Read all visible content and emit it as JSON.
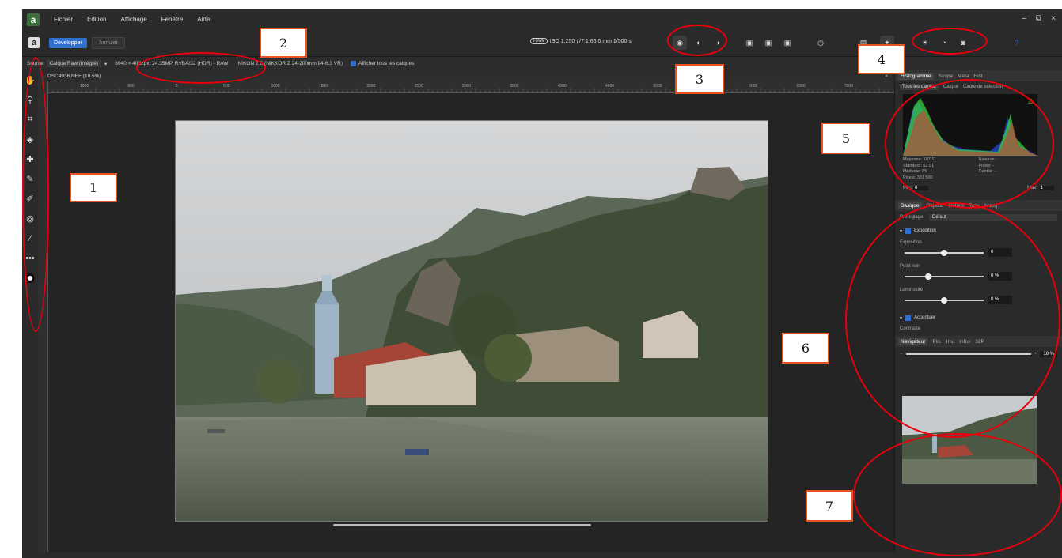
{
  "menubar": {
    "items": [
      "Fichier",
      "Edition",
      "Affichage",
      "Fenêtre",
      "Aide"
    ],
    "logo": "a"
  },
  "toolbar": {
    "develop_label": "Développer",
    "cancel_label": "Annuler",
    "raw_badge": "RAW",
    "exif": "ISO 1,250 ƒ/7.1 66.0 mm 1/500 s"
  },
  "context": {
    "source_label": "Source",
    "layer_select": "Calque Raw (intégré)",
    "dimensions": "6040 × 4032px, 24.35MP, RVBA/32 (HDR) - RAW",
    "camera": "NIKON Z 5 (NIKKOR Z 24-200mm f/4-6.3 VR)",
    "show_layers": "Afficher tous les calques"
  },
  "document": {
    "tab": "DSC4936.NEF (18.5%)",
    "close": "×"
  },
  "ruler": {
    "ticks": [
      "1000",
      "800",
      "0",
      "500",
      "1000",
      "1500",
      "2000",
      "2500",
      "3000",
      "3500",
      "4000",
      "4500",
      "5000",
      "5500",
      "6000",
      "6500",
      "7000"
    ]
  },
  "histogram": {
    "tabs": [
      "Histogramme",
      "Scope",
      "Méta",
      "Hist"
    ],
    "channel": "Tous les canaux",
    "options": [
      "Calque",
      "Cadre de sélection"
    ],
    "stats": [
      "Moyenne: 107.11",
      "Niveaux: -",
      "Standard: 62.91",
      "Pixels: -",
      "Médiane: 85",
      "Centile: -",
      "Pixels: 331 500",
      ""
    ],
    "min_label": "Min:",
    "min_value": "0",
    "max_label": "Max:",
    "max_value": "1"
  },
  "develop": {
    "tabs": [
      "Basique",
      "Objectif",
      "Détails",
      "Tons",
      "Masq"
    ],
    "preset_label": "Préréglage:",
    "preset_value": "Défaut",
    "exposure_group": "Exposition",
    "sliders": [
      {
        "label": "Exposition",
        "value": "0",
        "level": 0.5
      },
      {
        "label": "Point noir",
        "value": "0 %",
        "level": 0.3
      },
      {
        "label": "Luminosité",
        "value": "0 %",
        "level": 0.5
      }
    ],
    "sharpen_group": "Accentuer",
    "contrast_label": "Contraste"
  },
  "navigator": {
    "tabs": [
      "Navigateur",
      "Pin.",
      "Ins.",
      "Infos",
      "32P"
    ],
    "zoom": "18 %"
  },
  "annotations": {
    "labels": [
      "1",
      "2",
      "3",
      "4",
      "5",
      "6",
      "7"
    ]
  },
  "colors": {
    "accent": "#2f6fd1",
    "annotation_red": "#e8000b",
    "annotation_orange": "#e8541f"
  }
}
